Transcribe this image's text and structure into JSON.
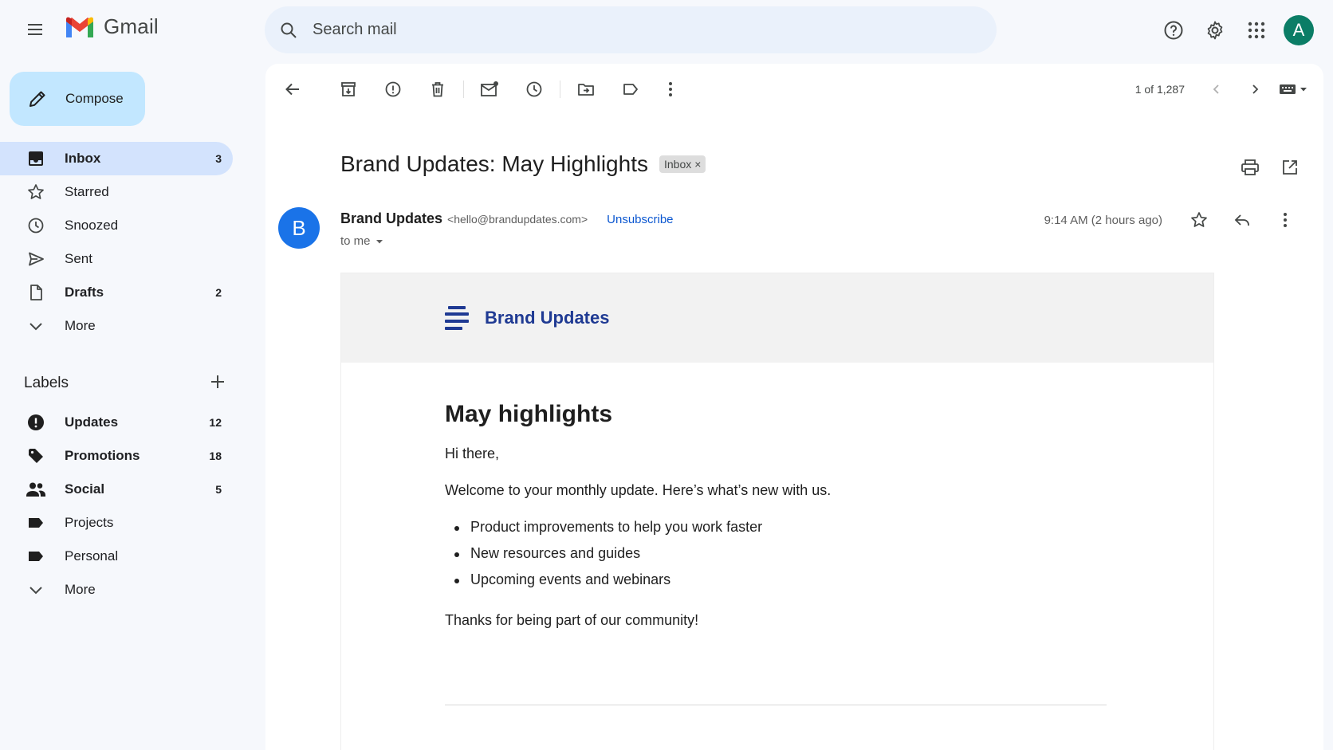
{
  "app": {
    "name": "Gmail"
  },
  "search": {
    "placeholder": "Search mail"
  },
  "account": {
    "avatar_letter": "A"
  },
  "compose": {
    "label": "Compose"
  },
  "nav": [
    {
      "label": "Inbox",
      "count": "3",
      "icon": "inbox-icon"
    },
    {
      "label": "Starred",
      "count": "",
      "icon": "star-icon"
    },
    {
      "label": "Snoozed",
      "count": "",
      "icon": "clock-icon"
    },
    {
      "label": "Sent",
      "count": "",
      "icon": "send-icon"
    },
    {
      "label": "Drafts",
      "count": "2",
      "icon": "draft-icon"
    },
    {
      "label": "More",
      "count": "",
      "icon": "chevron-down-icon"
    }
  ],
  "labels": {
    "title": "Labels",
    "items": [
      {
        "label": "Updates",
        "count": "12",
        "icon": "info-icon"
      },
      {
        "label": "Promotions",
        "count": "18",
        "icon": "tag-icon"
      },
      {
        "label": "Social",
        "count": "5",
        "icon": "people-icon"
      },
      {
        "label": "Projects",
        "count": "",
        "icon": "label-icon"
      },
      {
        "label": "Personal",
        "count": "",
        "icon": "label-icon"
      },
      {
        "label": "More",
        "count": "",
        "icon": "chevron-down-icon"
      }
    ]
  },
  "toolbar": {
    "pager": "1 of 1,287"
  },
  "email": {
    "subject": "Brand Updates: May Highlights",
    "chip": "Inbox",
    "chip_close": "×",
    "sender_initial": "B",
    "sender_name": "Brand Updates",
    "sender_email": "<hello@brandupdates.com>",
    "unsubscribe": "Unsubscribe",
    "to": "to me",
    "timestamp": "9:14 AM (2 hours ago)",
    "brand": "Brand Updates",
    "heading": "May highlights",
    "greeting": "Hi there,",
    "intro": "Welcome to your monthly update. Here’s what’s new with us.",
    "bullets": [
      "Product improvements to help you work faster",
      "New resources and guides",
      "Upcoming events and webinars"
    ],
    "thanks": "Thanks for being part of our community!"
  },
  "colors": {
    "accent": "#0b57d0",
    "compose_bg": "#c2e7ff",
    "active_nav": "#d3e3fd",
    "sender_avatar": "#1a73e8",
    "account_avatar": "#0b7d66",
    "brand_text": "#1f3a93"
  }
}
